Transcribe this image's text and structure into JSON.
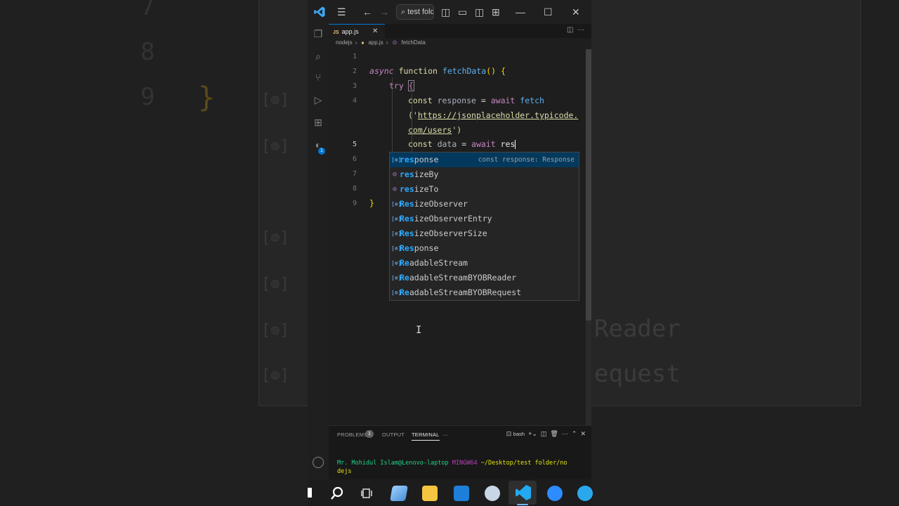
{
  "window": {
    "command_center": "test fold"
  },
  "tabs": [
    {
      "label": "app.js",
      "badge": "JS"
    }
  ],
  "breadcrumb": [
    "nodejs",
    "app.js",
    "fetchData"
  ],
  "editor": {
    "line_numbers": [
      "1",
      "2",
      "3",
      "4",
      "",
      "",
      "5",
      "6",
      "7",
      "8",
      "9"
    ],
    "lines": {
      "l2_async": "async",
      "l2_function": "function",
      "l2_name": "fetchData",
      "l2_rest": "() {",
      "l3_try": "try",
      "l3_brace": "{",
      "l4_const": "const",
      "l4_var": "response",
      "l4_eq": " = ",
      "l4_await": "await",
      "l4_fetch": "fetch",
      "l4b_open": "('",
      "l4b_url1": "https://jsonplaceholder.typicode.",
      "l4c_url2": "com/users",
      "l4c_close": "')",
      "l5_const": "const",
      "l5_var": "data",
      "l5_eq": " = ",
      "l5_await": "await",
      "l5_typed": "res",
      "l9_brace": "}"
    }
  },
  "suggest": {
    "items": [
      {
        "match": "res",
        "rest": "ponse",
        "kind": "variable",
        "detail": "const response: Response",
        "selected": true
      },
      {
        "match": "res",
        "rest": "izeBy",
        "kind": "method",
        "detail": "",
        "selected": false
      },
      {
        "match": "res",
        "rest": "izeTo",
        "kind": "method",
        "detail": "",
        "selected": false
      },
      {
        "match": "Res",
        "rest": "izeObserver",
        "kind": "variable",
        "detail": "",
        "selected": false
      },
      {
        "match": "Res",
        "rest": "izeObserverEntry",
        "kind": "variable",
        "detail": "",
        "selected": false
      },
      {
        "match": "Res",
        "rest": "izeObserverSize",
        "kind": "variable",
        "detail": "",
        "selected": false
      },
      {
        "match": "Res",
        "rest": "ponse",
        "kind": "variable",
        "detail": "",
        "selected": false
      },
      {
        "match": "Re",
        "rest": "adableStream",
        "kind": "variable",
        "detail": "",
        "selected": false
      },
      {
        "match": "Re",
        "rest": "adableStreamBYOBReader",
        "kind": "variable",
        "detail": "",
        "selected": false
      },
      {
        "match": "Re",
        "rest": "adableStreamBYOBRequest",
        "kind": "variable",
        "detail": "",
        "selected": false
      }
    ]
  },
  "panel": {
    "tabs": [
      "PROBLEMS",
      "OUTPUT",
      "TERMINAL"
    ],
    "problems_count": "1",
    "shell": "bash",
    "terminal": {
      "user": "Mr. Mohidul Islam@Lenovo-laptop",
      "host": "MINGW64",
      "path": "~/Desktop/test folder/no",
      "path_wrap": "dejs"
    }
  },
  "background": {
    "line_numbers": [
      "7",
      "8",
      "9"
    ],
    "words": [
      "Reader",
      "equest"
    ]
  },
  "colors": {
    "accent": "#0078d4",
    "editor_bg": "#1e1e1e",
    "suggest_selected": "#04395e"
  }
}
